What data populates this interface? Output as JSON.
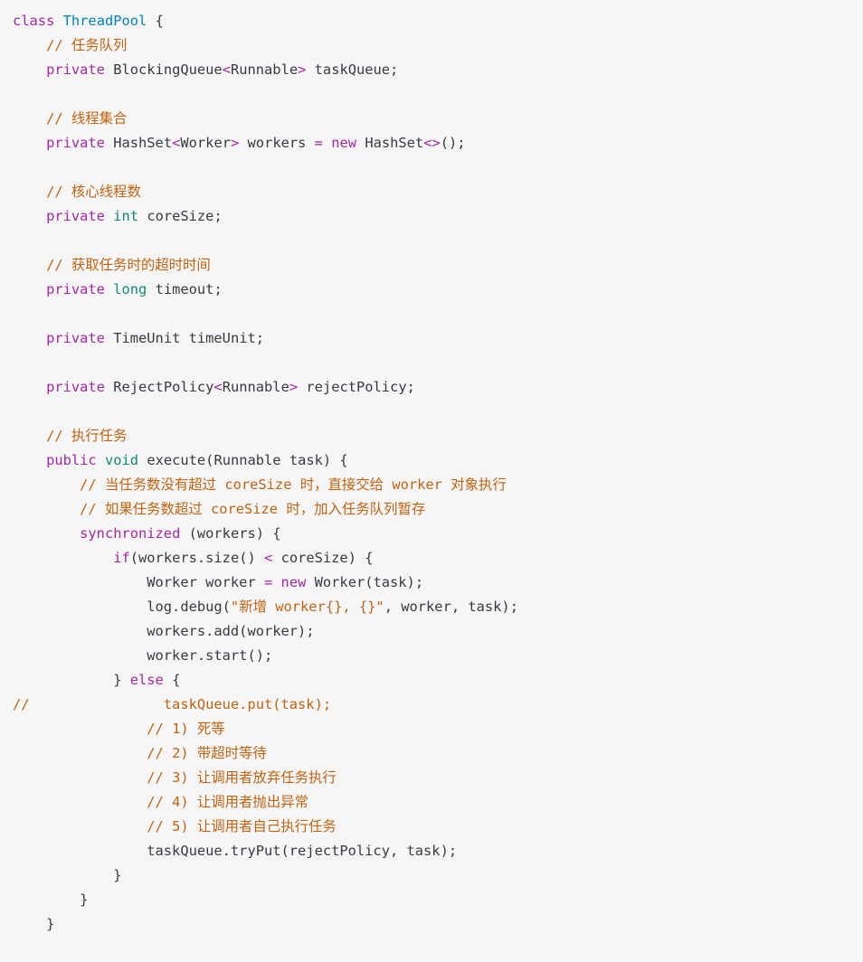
{
  "code": {
    "lines": [
      [
        {
          "t": "class",
          "c": "kw"
        },
        {
          "t": " ",
          "c": "pl"
        },
        {
          "t": "ThreadPool",
          "c": "ty"
        },
        {
          "t": " {",
          "c": "pl"
        }
      ],
      [
        {
          "t": "    ",
          "c": "pl"
        },
        {
          "t": "// 任务队列",
          "c": "cm"
        }
      ],
      [
        {
          "t": "    ",
          "c": "pl"
        },
        {
          "t": "private",
          "c": "kw"
        },
        {
          "t": " BlockingQueue",
          "c": "pl"
        },
        {
          "t": "<",
          "c": "kw"
        },
        {
          "t": "Runnable",
          "c": "pl"
        },
        {
          "t": ">",
          "c": "kw"
        },
        {
          "t": " taskQueue;",
          "c": "pl"
        }
      ],
      [
        {
          "t": "",
          "c": "pl"
        }
      ],
      [
        {
          "t": "    ",
          "c": "pl"
        },
        {
          "t": "// 线程集合",
          "c": "cm"
        }
      ],
      [
        {
          "t": "    ",
          "c": "pl"
        },
        {
          "t": "private",
          "c": "kw"
        },
        {
          "t": " HashSet",
          "c": "pl"
        },
        {
          "t": "<",
          "c": "kw"
        },
        {
          "t": "Worker",
          "c": "pl"
        },
        {
          "t": ">",
          "c": "kw"
        },
        {
          "t": " workers ",
          "c": "pl"
        },
        {
          "t": "=",
          "c": "kw"
        },
        {
          "t": " ",
          "c": "pl"
        },
        {
          "t": "new",
          "c": "kw"
        },
        {
          "t": " HashSet",
          "c": "pl"
        },
        {
          "t": "<>",
          "c": "kw"
        },
        {
          "t": "();",
          "c": "pl"
        }
      ],
      [
        {
          "t": "",
          "c": "pl"
        }
      ],
      [
        {
          "t": "    ",
          "c": "pl"
        },
        {
          "t": "// 核心线程数",
          "c": "cm"
        }
      ],
      [
        {
          "t": "    ",
          "c": "pl"
        },
        {
          "t": "private",
          "c": "kw"
        },
        {
          "t": " ",
          "c": "pl"
        },
        {
          "t": "int",
          "c": "prim"
        },
        {
          "t": " coreSize;",
          "c": "pl"
        }
      ],
      [
        {
          "t": "",
          "c": "pl"
        }
      ],
      [
        {
          "t": "    ",
          "c": "pl"
        },
        {
          "t": "// 获取任务时的超时时间",
          "c": "cm"
        }
      ],
      [
        {
          "t": "    ",
          "c": "pl"
        },
        {
          "t": "private",
          "c": "kw"
        },
        {
          "t": " ",
          "c": "pl"
        },
        {
          "t": "long",
          "c": "prim"
        },
        {
          "t": " timeout;",
          "c": "pl"
        }
      ],
      [
        {
          "t": "",
          "c": "pl"
        }
      ],
      [
        {
          "t": "    ",
          "c": "pl"
        },
        {
          "t": "private",
          "c": "kw"
        },
        {
          "t": " TimeUnit timeUnit;",
          "c": "pl"
        }
      ],
      [
        {
          "t": "",
          "c": "pl"
        }
      ],
      [
        {
          "t": "    ",
          "c": "pl"
        },
        {
          "t": "private",
          "c": "kw"
        },
        {
          "t": " RejectPolicy",
          "c": "pl"
        },
        {
          "t": "<",
          "c": "kw"
        },
        {
          "t": "Runnable",
          "c": "pl"
        },
        {
          "t": ">",
          "c": "kw"
        },
        {
          "t": " rejectPolicy;",
          "c": "pl"
        }
      ],
      [
        {
          "t": "",
          "c": "pl"
        }
      ],
      [
        {
          "t": "    ",
          "c": "pl"
        },
        {
          "t": "// 执行任务",
          "c": "cm"
        }
      ],
      [
        {
          "t": "    ",
          "c": "pl"
        },
        {
          "t": "public",
          "c": "kw"
        },
        {
          "t": " ",
          "c": "pl"
        },
        {
          "t": "void",
          "c": "prim"
        },
        {
          "t": " execute(Runnable task) {",
          "c": "pl"
        }
      ],
      [
        {
          "t": "        ",
          "c": "pl"
        },
        {
          "t": "// 当任务数没有超过 coreSize 时，直接交给 worker 对象执行",
          "c": "cm"
        }
      ],
      [
        {
          "t": "        ",
          "c": "pl"
        },
        {
          "t": "// 如果任务数超过 coreSize 时，加入任务队列暂存",
          "c": "cm"
        }
      ],
      [
        {
          "t": "        ",
          "c": "pl"
        },
        {
          "t": "synchronized",
          "c": "kw"
        },
        {
          "t": " (workers) {",
          "c": "pl"
        }
      ],
      [
        {
          "t": "            ",
          "c": "pl"
        },
        {
          "t": "if",
          "c": "kw"
        },
        {
          "t": "(workers.size() ",
          "c": "pl"
        },
        {
          "t": "<",
          "c": "kw"
        },
        {
          "t": " coreSize) {",
          "c": "pl"
        }
      ],
      [
        {
          "t": "                Worker worker ",
          "c": "pl"
        },
        {
          "t": "=",
          "c": "kw"
        },
        {
          "t": " ",
          "c": "pl"
        },
        {
          "t": "new",
          "c": "kw"
        },
        {
          "t": " Worker(task);",
          "c": "pl"
        }
      ],
      [
        {
          "t": "                log.debug(",
          "c": "pl"
        },
        {
          "t": "\"新增 worker{}, {}\"",
          "c": "str"
        },
        {
          "t": ", worker, task);",
          "c": "pl"
        }
      ],
      [
        {
          "t": "                workers.add(worker);",
          "c": "pl"
        }
      ],
      [
        {
          "t": "                worker.start();",
          "c": "pl"
        }
      ],
      [
        {
          "t": "            } ",
          "c": "pl"
        },
        {
          "t": "else",
          "c": "kw"
        },
        {
          "t": " {",
          "c": "pl"
        }
      ],
      [
        {
          "t": "//                taskQueue.put(task);",
          "c": "cm"
        }
      ],
      [
        {
          "t": "                ",
          "c": "pl"
        },
        {
          "t": "// 1) 死等",
          "c": "cm"
        }
      ],
      [
        {
          "t": "                ",
          "c": "pl"
        },
        {
          "t": "// 2) 带超时等待",
          "c": "cm"
        }
      ],
      [
        {
          "t": "                ",
          "c": "pl"
        },
        {
          "t": "// 3) 让调用者放弃任务执行",
          "c": "cm"
        }
      ],
      [
        {
          "t": "                ",
          "c": "pl"
        },
        {
          "t": "// 4) 让调用者抛出异常",
          "c": "cm"
        }
      ],
      [
        {
          "t": "                ",
          "c": "pl"
        },
        {
          "t": "// 5) 让调用者自己执行任务",
          "c": "cm"
        }
      ],
      [
        {
          "t": "                taskQueue.tryPut(rejectPolicy, task);",
          "c": "pl"
        }
      ],
      [
        {
          "t": "            }",
          "c": "pl"
        }
      ],
      [
        {
          "t": "        }",
          "c": "pl"
        }
      ],
      [
        {
          "t": "    }",
          "c": "pl"
        }
      ]
    ]
  },
  "colors": {
    "background": "#f6f6f7",
    "keyword": "#a626a4",
    "type": "#0184bc",
    "primitive": "#0f8b76",
    "comment": "#c3620f",
    "plain": "#383a42"
  }
}
